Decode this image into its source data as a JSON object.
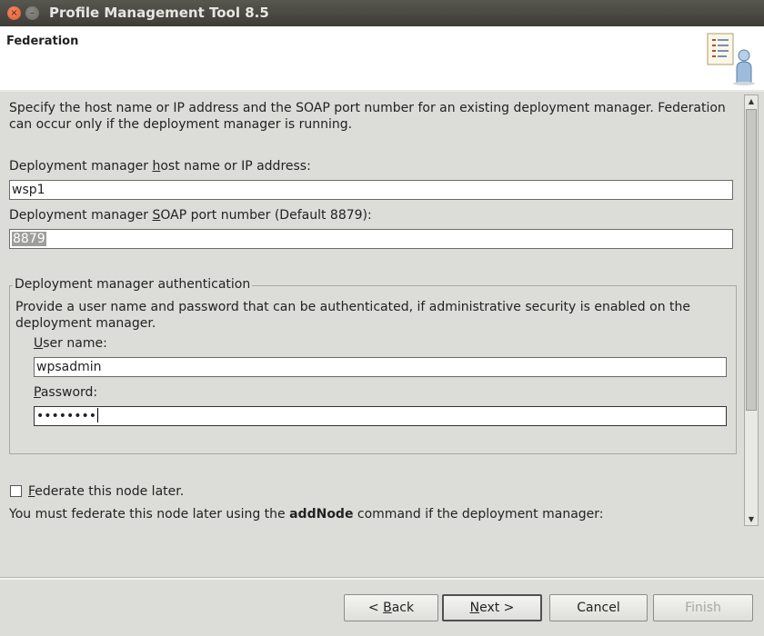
{
  "window": {
    "title": "Profile Management Tool 8.5",
    "close_glyph": "×",
    "minimize_glyph": "–"
  },
  "header": {
    "title": "Federation"
  },
  "intro_text": "Specify the host name or IP address and the SOAP port number for an existing deployment manager. Federation can occur only if the deployment manager is running.",
  "host": {
    "label_pre": "Deployment manager ",
    "label_mnemonic": "h",
    "label_post": "ost name or IP address:",
    "value": "wsp1"
  },
  "soap": {
    "label_pre": "Deployment manager ",
    "label_mnemonic": "S",
    "label_post": "OAP port number (Default 8879):",
    "value": "8879"
  },
  "auth": {
    "legend": "Deployment manager authentication",
    "description": "Provide a user name and password that can be authenticated, if administrative security is enabled on the deployment manager.",
    "username": {
      "label_mnemonic": "U",
      "label_rest": "ser name:",
      "value": "wpsadmin"
    },
    "password": {
      "label_mnemonic": "P",
      "label_rest": "assword:",
      "masked_value": "••••••••"
    }
  },
  "federate_later": {
    "checked": false,
    "label_mnemonic": "F",
    "label_rest": "ederate this node later."
  },
  "note": {
    "pre": "You must federate this node later using the ",
    "command": "addNode",
    "post": " command if the deployment manager:"
  },
  "scrollbar": {
    "up_glyph": "▲",
    "down_glyph": "▼"
  },
  "buttons": {
    "back": {
      "pre": "< ",
      "mnemonic": "B",
      "rest": "ack"
    },
    "next": {
      "mnemonic": "N",
      "rest": "ext >"
    },
    "cancel": "Cancel",
    "finish": "Finish"
  },
  "colors": {
    "title_bar": "#3d3c37",
    "close_button": "#e0592f",
    "background": "#dcdcd8"
  }
}
